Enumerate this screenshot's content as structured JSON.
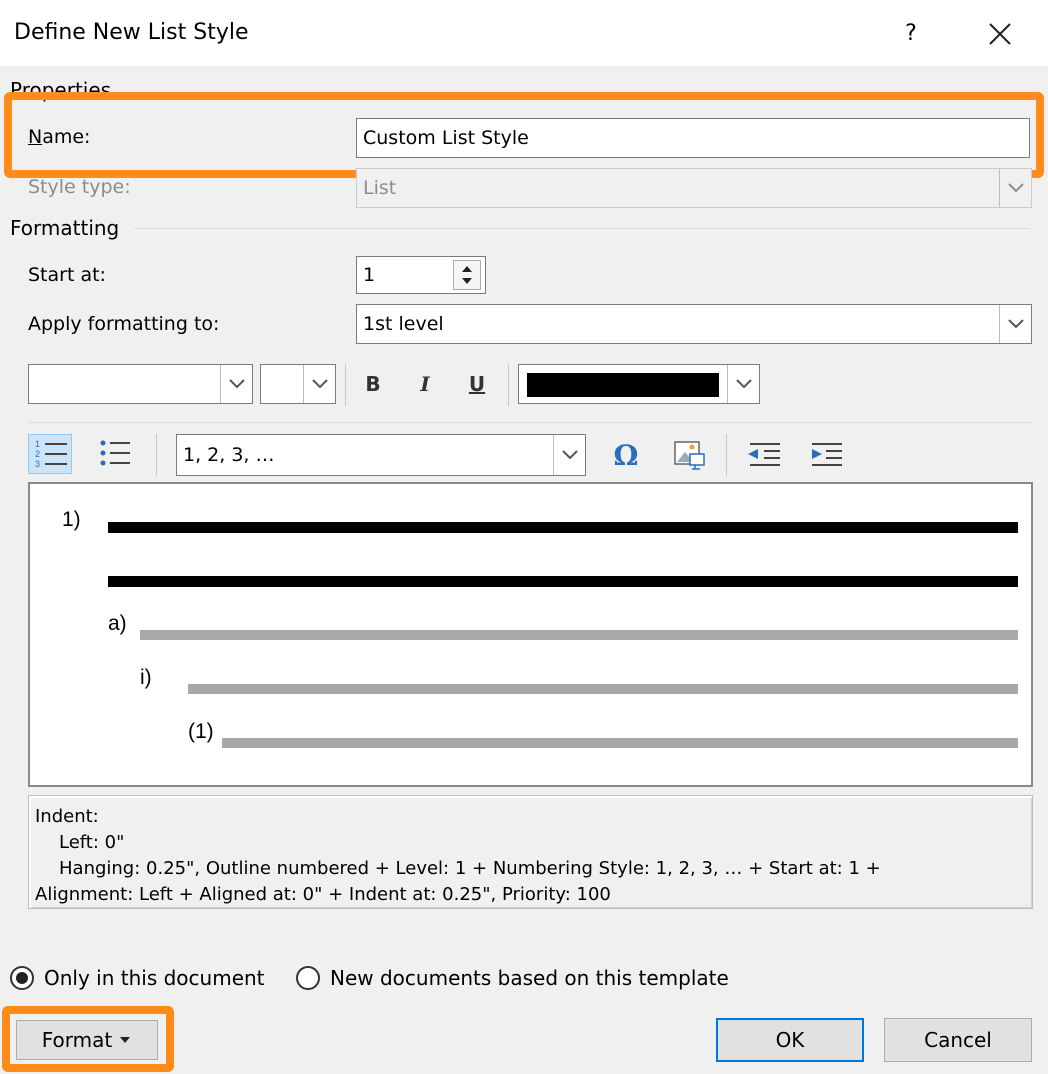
{
  "dialog": {
    "title": "Define New List Style",
    "help": "?"
  },
  "properties": {
    "section": "Properties",
    "name_label": "Name:",
    "name_value": "Custom List Style",
    "style_type_label": "Style type:",
    "style_type_value": "List"
  },
  "formatting": {
    "section": "Formatting",
    "start_at_label": "Start at:",
    "start_at_value": "1",
    "apply_to_label": "Apply formatting to:",
    "apply_to_value": "1st level",
    "font_value": "",
    "size_value": "",
    "bold": "B",
    "italic": "I",
    "underline": "U",
    "color": "#000000",
    "numbering_style_value": "1, 2, 3, …",
    "symbol_glyph": "Ω"
  },
  "preview": {
    "level1": "1)",
    "level2": "a)",
    "level3": "i)",
    "level4": "(1)"
  },
  "description": {
    "line1": "Indent:",
    "line2": "Left:  0\"",
    "line3": "Hanging:  0.25\", Outline numbered + Level: 1 + Numbering Style: 1, 2, 3, … + Start at: 1 +",
    "line4": "Alignment: Left + Aligned at:  0\" + Indent at:  0.25\", Priority: 100"
  },
  "scope": {
    "only_this_document": "Only in this document",
    "new_documents": "New documents based on this template",
    "selected": "only_this_document"
  },
  "buttons": {
    "format": "Format",
    "ok": "OK",
    "cancel": "Cancel"
  },
  "highlight_color": "#ff8c1a"
}
